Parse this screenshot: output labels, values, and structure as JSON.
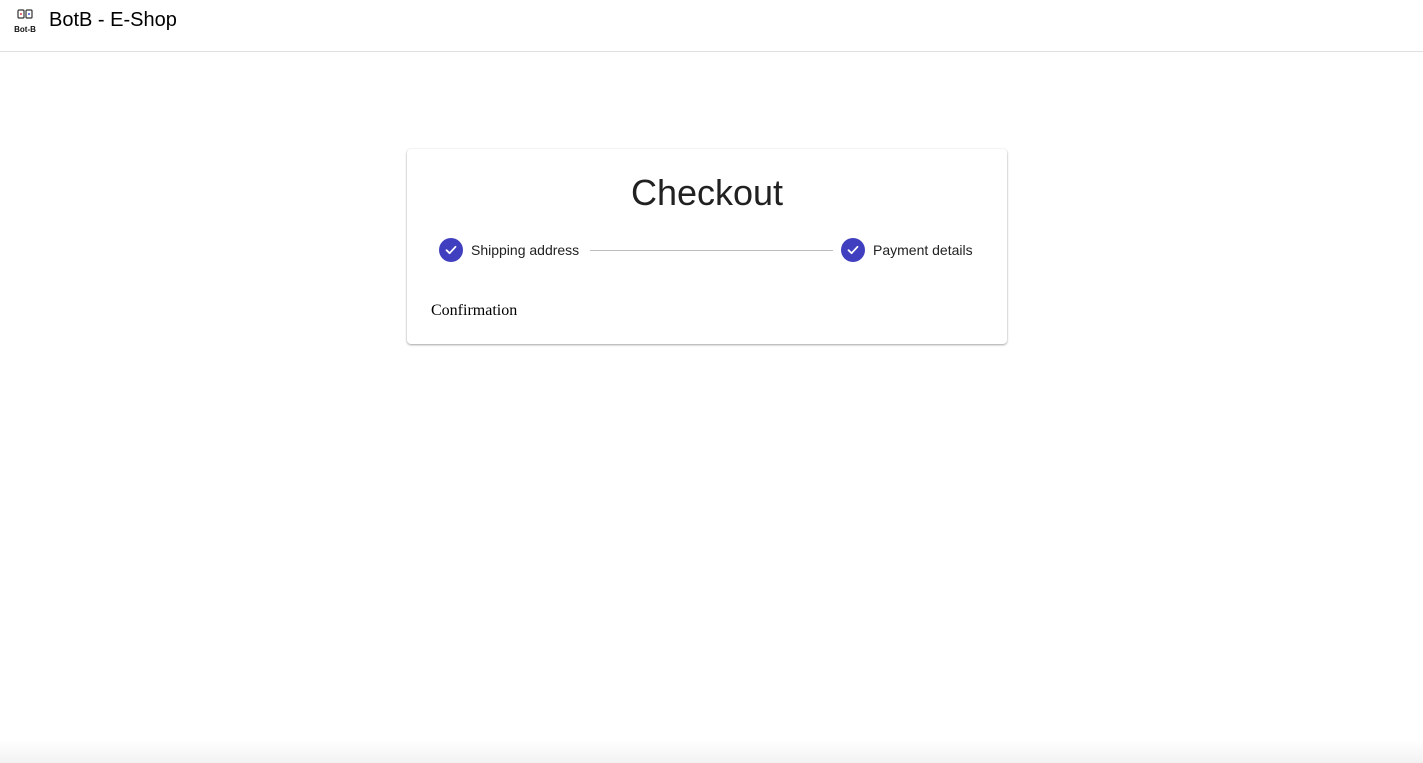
{
  "header": {
    "logo_icon": "bot-b-logo-icon",
    "logo_caption": "Bot-B",
    "app_title": "BotB - E-Shop"
  },
  "checkout": {
    "title": "Checkout",
    "steps": [
      {
        "label": "Shipping address",
        "status": "completed",
        "icon": "check-icon"
      },
      {
        "label": "Payment details",
        "status": "completed",
        "icon": "check-icon"
      }
    ],
    "confirmation_text": "Confirmation"
  },
  "colors": {
    "accent": "#3f3fbf",
    "text": "#212121",
    "divider": "#e0e0e0"
  }
}
